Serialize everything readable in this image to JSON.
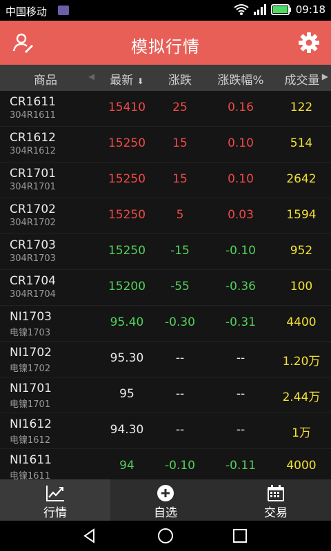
{
  "status": {
    "carrier": "中国移动",
    "time": "09:18"
  },
  "titlebar": {
    "title": "模拟行情",
    "left_icon": "user-edit-icon",
    "right_icon": "gear-icon"
  },
  "header": {
    "product": "商品",
    "latest": "最新",
    "change": "涨跌",
    "change_pct": "涨跌幅%",
    "volume": "成交量",
    "sort_icon": "sort-down-icon"
  },
  "rows": [
    {
      "code": "CR1611",
      "sub": "304R1611",
      "latest": "15410",
      "change": "25",
      "pct": "0.16",
      "vol": "122",
      "color": "red"
    },
    {
      "code": "CR1612",
      "sub": "304R1612",
      "latest": "15250",
      "change": "15",
      "pct": "0.10",
      "vol": "514",
      "color": "red"
    },
    {
      "code": "CR1701",
      "sub": "304R1701",
      "latest": "15250",
      "change": "15",
      "pct": "0.10",
      "vol": "2642",
      "color": "red"
    },
    {
      "code": "CR1702",
      "sub": "304R1702",
      "latest": "15250",
      "change": "5",
      "pct": "0.03",
      "vol": "1594",
      "color": "red"
    },
    {
      "code": "CR1703",
      "sub": "304R1703",
      "latest": "15250",
      "change": "-15",
      "pct": "-0.10",
      "vol": "952",
      "color": "green"
    },
    {
      "code": "CR1704",
      "sub": "304R1704",
      "latest": "15200",
      "change": "-55",
      "pct": "-0.36",
      "vol": "100",
      "color": "green"
    },
    {
      "code": "NI1703",
      "sub": "电镍1703",
      "latest": "95.40",
      "change": "-0.30",
      "pct": "-0.31",
      "vol": "4400",
      "color": "green"
    },
    {
      "code": "NI1702",
      "sub": "电镍1702",
      "latest": "95.30",
      "change": "--",
      "pct": "--",
      "vol": "1.20万",
      "color": "white"
    },
    {
      "code": "NI1701",
      "sub": "电镍1701",
      "latest": "95",
      "change": "--",
      "pct": "--",
      "vol": "2.44万",
      "color": "white"
    },
    {
      "code": "NI1612",
      "sub": "电镍1612",
      "latest": "94.30",
      "change": "--",
      "pct": "--",
      "vol": "1万",
      "color": "white"
    },
    {
      "code": "NI1611",
      "sub": "电镍1611",
      "latest": "94",
      "change": "-0.10",
      "pct": "-0.11",
      "vol": "4000",
      "color": "green"
    }
  ],
  "tabs": [
    {
      "label": "行情",
      "icon": "chart-line-icon",
      "active": true
    },
    {
      "label": "自选",
      "icon": "plus-circle-icon",
      "active": false
    },
    {
      "label": "交易",
      "icon": "calendar-icon",
      "active": false
    }
  ],
  "colors": {
    "accent": "#e85f57",
    "up": "#f04848",
    "down": "#52d15a",
    "volume": "#f2e032"
  }
}
